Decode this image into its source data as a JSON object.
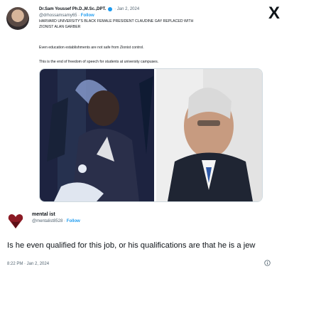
{
  "quoted_tweet": {
    "author_name": "Dr.Sam Youssef Ph.D.,M.Sc.,DPT.",
    "date": "· Jan 2, 2024",
    "handle": "@drhossamsamy65",
    "follow_label": "Follow",
    "text_line1": "HARVARD UNIVERSITY'S BLACK FEMALE PRESIDENT CLAUDINE GAY REPLACED WITH",
    "text_line2": "ZIONIST ALAN GARBER",
    "paragraph2": "Even education establishments are not safe from Zionist control.",
    "paragraph3": "This is the end of freedom of speech for students at university campuses."
  },
  "platform_logo": "X",
  "main_tweet": {
    "author_name": "mental ist",
    "handle": "@mentalist8528",
    "follow_label": "Follow",
    "text": "Is he even qualified for this job, or his qualifications are that he is a jew",
    "timestamp": "8:22 PM · Jan 2, 2024"
  },
  "colors": {
    "accent": "#1d9bf0",
    "text": "#0f1419",
    "muted": "#536471"
  }
}
